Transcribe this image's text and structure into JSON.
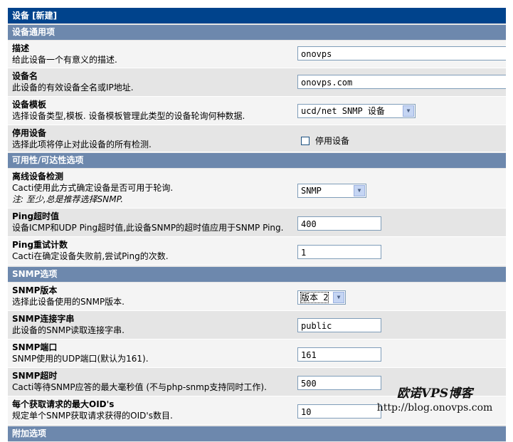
{
  "title": "设备 [新建]",
  "sections": {
    "general": "设备通用项",
    "availability": "可用性/可达性选项",
    "snmp": "SNMP选项",
    "additional": "附加选项"
  },
  "fields": {
    "description": {
      "name": "描述",
      "desc": "给此设备一个有意义的描述.",
      "value": "onovps"
    },
    "hostname": {
      "name": "设备名",
      "desc": "此设备的有效设备全名或IP地址.",
      "value": "onovps.com"
    },
    "template": {
      "name": "设备模板",
      "desc": "选择设备类型,模板. 设备模板管理此类型的设备轮询何种数据.",
      "value": "ucd/net SNMP 设备"
    },
    "disable": {
      "name": "停用设备",
      "desc": "选择此项将停止对此设备的所有检测.",
      "checkbox_label": "停用设备",
      "checked": false
    },
    "availability_method": {
      "name": "离线设备检测",
      "desc": "Cacti使用此方式确定设备是否可用于轮询.",
      "note": "注: 至少,总是推荐选择SNMP.",
      "value": "SNMP"
    },
    "ping_timeout": {
      "name": "Ping超时值",
      "desc": "设备ICMP和UDP Ping超时值,此设备SNMP的超时值应用于SNMP Ping.",
      "value": "400"
    },
    "ping_retries": {
      "name": "Ping重试计数",
      "desc": "Cacti在确定设备失败前,尝试Ping的次数.",
      "value": "1"
    },
    "snmp_version": {
      "name": "SNMP版本",
      "desc": "选择此设备使用的SNMP版本.",
      "value": "版本 2"
    },
    "snmp_community": {
      "name": "SNMP连接字串",
      "desc": "此设备的SNMP读取连接字串.",
      "value": "public"
    },
    "snmp_port": {
      "name": "SNMP端口",
      "desc": "SNMP使用的UDP端口(默认为161).",
      "value": "161"
    },
    "snmp_timeout": {
      "name": "SNMP超时",
      "desc": "Cacti等待SNMP应答的最大毫秒值 (不与php-snmp支持同时工作).",
      "value": "500"
    },
    "max_oids": {
      "name": "每个获取请求的最大OID's",
      "desc": "规定单个SNMP获取请求获得的OID's数目.",
      "value": "10"
    }
  },
  "watermark": {
    "title": "欧诺VPS博客",
    "url": "http://blog.onovps.com"
  },
  "colors": {
    "title_bar": "#00438c",
    "section_bar": "#6d88ad",
    "row_light": "#f4f4f4",
    "row_dark": "#e5e5e5"
  }
}
